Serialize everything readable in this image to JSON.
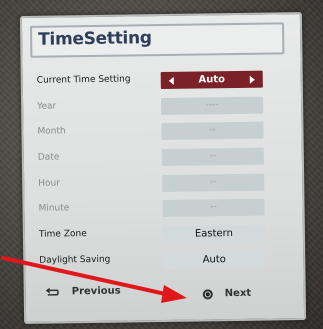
{
  "screen": {
    "title": "TimeSetting"
  },
  "rows": [
    {
      "label": "Current Time Setting",
      "value": "Auto",
      "state": "active"
    },
    {
      "label": "Year",
      "value": "----",
      "state": "disabled"
    },
    {
      "label": "Month",
      "value": "--",
      "state": "disabled"
    },
    {
      "label": "Date",
      "value": "--",
      "state": "disabled"
    },
    {
      "label": "Hour",
      "value": "--",
      "state": "disabled"
    },
    {
      "label": "Minute",
      "value": "--",
      "state": "disabled"
    },
    {
      "label": "Time Zone",
      "value": "Eastern",
      "state": "enabled"
    },
    {
      "label": "Daylight Saving",
      "value": "Auto",
      "state": "enabled"
    }
  ],
  "footer": {
    "previous_label": "Previous",
    "next_label": "Next"
  },
  "colors": {
    "title": "#2d3f5b",
    "active_field": "#7a2228",
    "annotation_arrow": "#e0181b"
  },
  "icons": {
    "previous": "return-arrow-icon",
    "next": "radio-dot-icon",
    "left": "triangle-left-icon",
    "right": "triangle-right-icon"
  }
}
